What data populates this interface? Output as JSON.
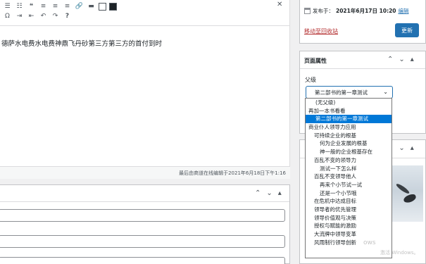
{
  "editor": {
    "content_text": "德萨水电费水电费神鼎飞丹砂第三方第三方的首付到时",
    "status_text": "最后由商道在线编辑于2021年6月18日下午1:16",
    "toolbar_icons_row1": [
      "unordered-list-icon",
      "ordered-list-icon",
      "blockquote-icon",
      "align-left-icon",
      "align-center-icon",
      "align-right-icon",
      "link-icon",
      "more-tag-icon",
      "fullscreen-box-icon",
      "toolbar-toggle-icon"
    ],
    "toolbar_icons_row2": [
      "omega-icon",
      "indent-icon",
      "outdent-icon",
      "undo-icon",
      "redo-icon",
      "help-icon"
    ]
  },
  "publish": {
    "published_label": "发布于：",
    "published_date": "2021年6月17日 10:20",
    "edit_link": "编辑",
    "trash_link": "移动至回收站",
    "update_button": "更新"
  },
  "page_attributes": {
    "title": "页面属性",
    "parent_label": "父级",
    "selected_parent": "第二部书的第一章测试"
  },
  "parent_options": [
    {
      "label": "(无父级)",
      "selected": false
    },
    {
      "label": "再加一本书看看",
      "selected": false
    },
    {
      "label": "第二部书的第一章测试",
      "selected": true
    },
    {
      "label": "商业仆人领导力应用",
      "selected": false
    },
    {
      "label": "可持续企业的根基",
      "selected": false
    },
    {
      "label": "何为企业发展的根基",
      "selected": false
    },
    {
      "label": "神一般的企业根基存在",
      "selected": false
    },
    {
      "label": "百乱不变的领导力",
      "selected": false
    },
    {
      "label": "测试一下怎么样",
      "selected": false
    },
    {
      "label": "百乱不变领导他人",
      "selected": false
    },
    {
      "label": "再来个小节试一试",
      "selected": false
    },
    {
      "label": "还是一个小节哦",
      "selected": false
    },
    {
      "label": "在危机中达成目标",
      "selected": false
    },
    {
      "label": "领导者的优先管理",
      "selected": false
    },
    {
      "label": "领导价值观与决策",
      "selected": false
    },
    {
      "label": "授权与赋能的激励",
      "selected": false
    },
    {
      "label": "大流牌中领导变革",
      "selected": false
    },
    {
      "label": "风雨制行领导创新",
      "selected": false
    }
  ],
  "watermark": {
    "line1": "ows",
    "line2": "激活 Windows。"
  }
}
